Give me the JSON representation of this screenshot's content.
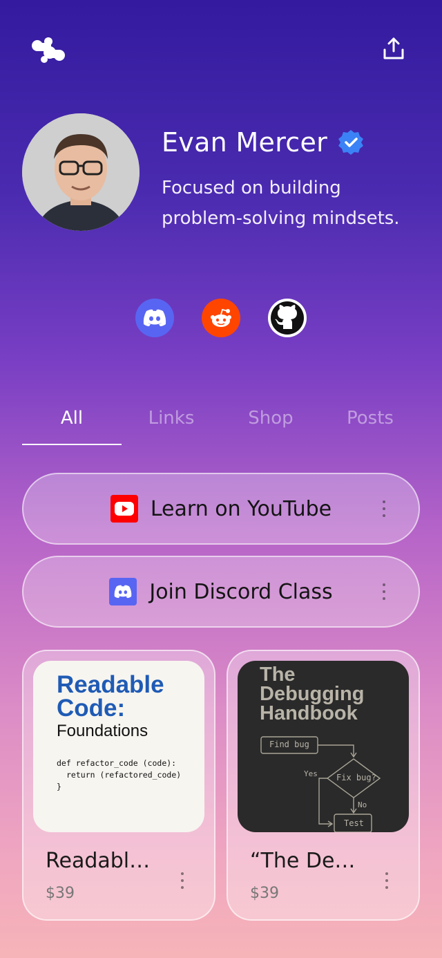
{
  "profile": {
    "name": "Evan Mercer",
    "bio": "Focused on building problem-solving mindsets."
  },
  "tabs": [
    {
      "label": "All",
      "active": true
    },
    {
      "label": "Links"
    },
    {
      "label": "Shop"
    },
    {
      "label": "Posts"
    }
  ],
  "links": [
    {
      "label": "Learn on YouTube",
      "icon": "youtube-icon"
    },
    {
      "label": "Join Discord Class",
      "icon": "discord-icon"
    }
  ],
  "products": [
    {
      "title": "Readabl…",
      "price": "$39",
      "cover": {
        "heading": "Readable Code:",
        "subheading": "Foundations",
        "code_line1": "def refactor_code (code):",
        "code_line2": "return (refactored_code)",
        "code_line3": "}"
      }
    },
    {
      "title": "“The De…",
      "price": "$39",
      "cover": {
        "heading_line1": "The",
        "heading_line2": "Debugging",
        "heading_line3": "Handbook",
        "node_find": "Find bug",
        "node_fix": "Fix bug?",
        "node_test": "Test",
        "label_yes": "Yes",
        "label_no": "No"
      }
    }
  ],
  "colors": {
    "accent_verified": "#3b82f6",
    "discord": "#5865f2",
    "reddit": "#ff4500",
    "youtube": "#ff0000"
  }
}
